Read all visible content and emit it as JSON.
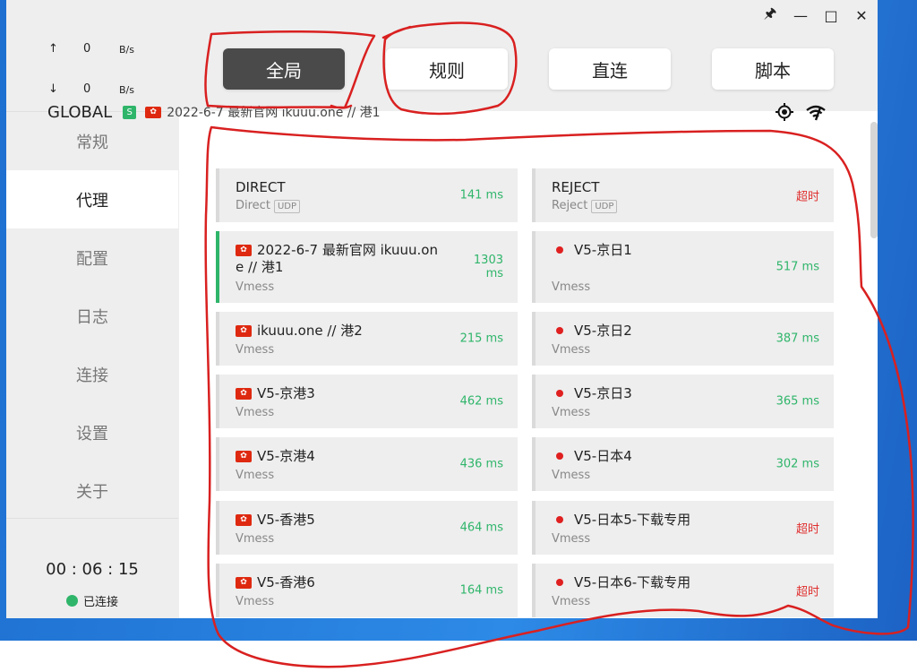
{
  "titlebar": {
    "pin_glyph": "🖈",
    "min_glyph": "—",
    "max_glyph": "□",
    "close_glyph": "✕"
  },
  "traffic": {
    "up": {
      "arrow": "↑",
      "value": "0",
      "unit": "B/s"
    },
    "down": {
      "arrow": "↓",
      "value": "0",
      "unit": "B/s"
    }
  },
  "nav": {
    "items": [
      "常规",
      "代理",
      "配置",
      "日志",
      "连接",
      "设置",
      "关于"
    ],
    "active_index": 1
  },
  "status": {
    "timer": "00 : 06 : 15",
    "label": "已连接",
    "color": "#2fb56a"
  },
  "modes": {
    "global": "全局",
    "rule": "规则",
    "direct": "直连",
    "script": "脚本",
    "active": "global"
  },
  "group": {
    "name": "GLOBAL",
    "badge": "S",
    "flag_text": "✿",
    "selected_node": "2022-6-7 最新官网 ikuuu.one // 港1",
    "icons": [
      "locate-icon",
      "speed-test-icon"
    ]
  },
  "proxies": [
    {
      "name": "DIRECT",
      "type": "Direct",
      "udp": "UDP",
      "delay": "141 ms",
      "flag": "",
      "timeout": false
    },
    {
      "name": "REJECT",
      "type": "Reject",
      "udp": "UDP",
      "delay": "超时",
      "flag": "",
      "timeout": true
    },
    {
      "name": "2022-6-7 最新官网 ikuuu.one // 港1",
      "name_line1": "2022-6-7 最新官网 ikuuu.on",
      "name_line2": "e // 港1",
      "type": "Vmess",
      "delay": "1303 ms",
      "delay_line1": "1303",
      "delay_line2": "ms",
      "flag": "hk",
      "timeout": false,
      "selected": true
    },
    {
      "name": "V5-京日1",
      "type": "Vmess",
      "delay": "517 ms",
      "flag": "jp",
      "timeout": false
    },
    {
      "name": "ikuuu.one // 港2",
      "type": "Vmess",
      "delay": "215 ms",
      "flag": "hk",
      "timeout": false
    },
    {
      "name": "V5-京日2",
      "type": "Vmess",
      "delay": "387 ms",
      "flag": "jp",
      "timeout": false
    },
    {
      "name": "V5-京港3",
      "type": "Vmess",
      "delay": "462 ms",
      "flag": "hk",
      "timeout": false
    },
    {
      "name": "V5-京日3",
      "type": "Vmess",
      "delay": "365 ms",
      "flag": "jp",
      "timeout": false
    },
    {
      "name": "V5-京港4",
      "type": "Vmess",
      "delay": "436 ms",
      "flag": "hk",
      "timeout": false
    },
    {
      "name": "V5-日本4",
      "type": "Vmess",
      "delay": "302 ms",
      "flag": "jp",
      "timeout": false
    },
    {
      "name": "V5-香港5",
      "type": "Vmess",
      "delay": "464 ms",
      "flag": "hk",
      "timeout": false
    },
    {
      "name": "V5-日本5-下载专用",
      "type": "Vmess",
      "delay": "超时",
      "flag": "jp",
      "timeout": true
    },
    {
      "name": "V5-香港6",
      "type": "Vmess",
      "delay": "164 ms",
      "flag": "hk",
      "timeout": false
    },
    {
      "name": "V5-日本6-下载专用",
      "type": "Vmess",
      "delay": "超时",
      "flag": "jp",
      "timeout": true
    }
  ],
  "colors": {
    "accent_green": "#2fb56a",
    "timeout_red": "#e03030",
    "annotation_red": "#d92020",
    "active_mode": "#4a4a4a"
  }
}
